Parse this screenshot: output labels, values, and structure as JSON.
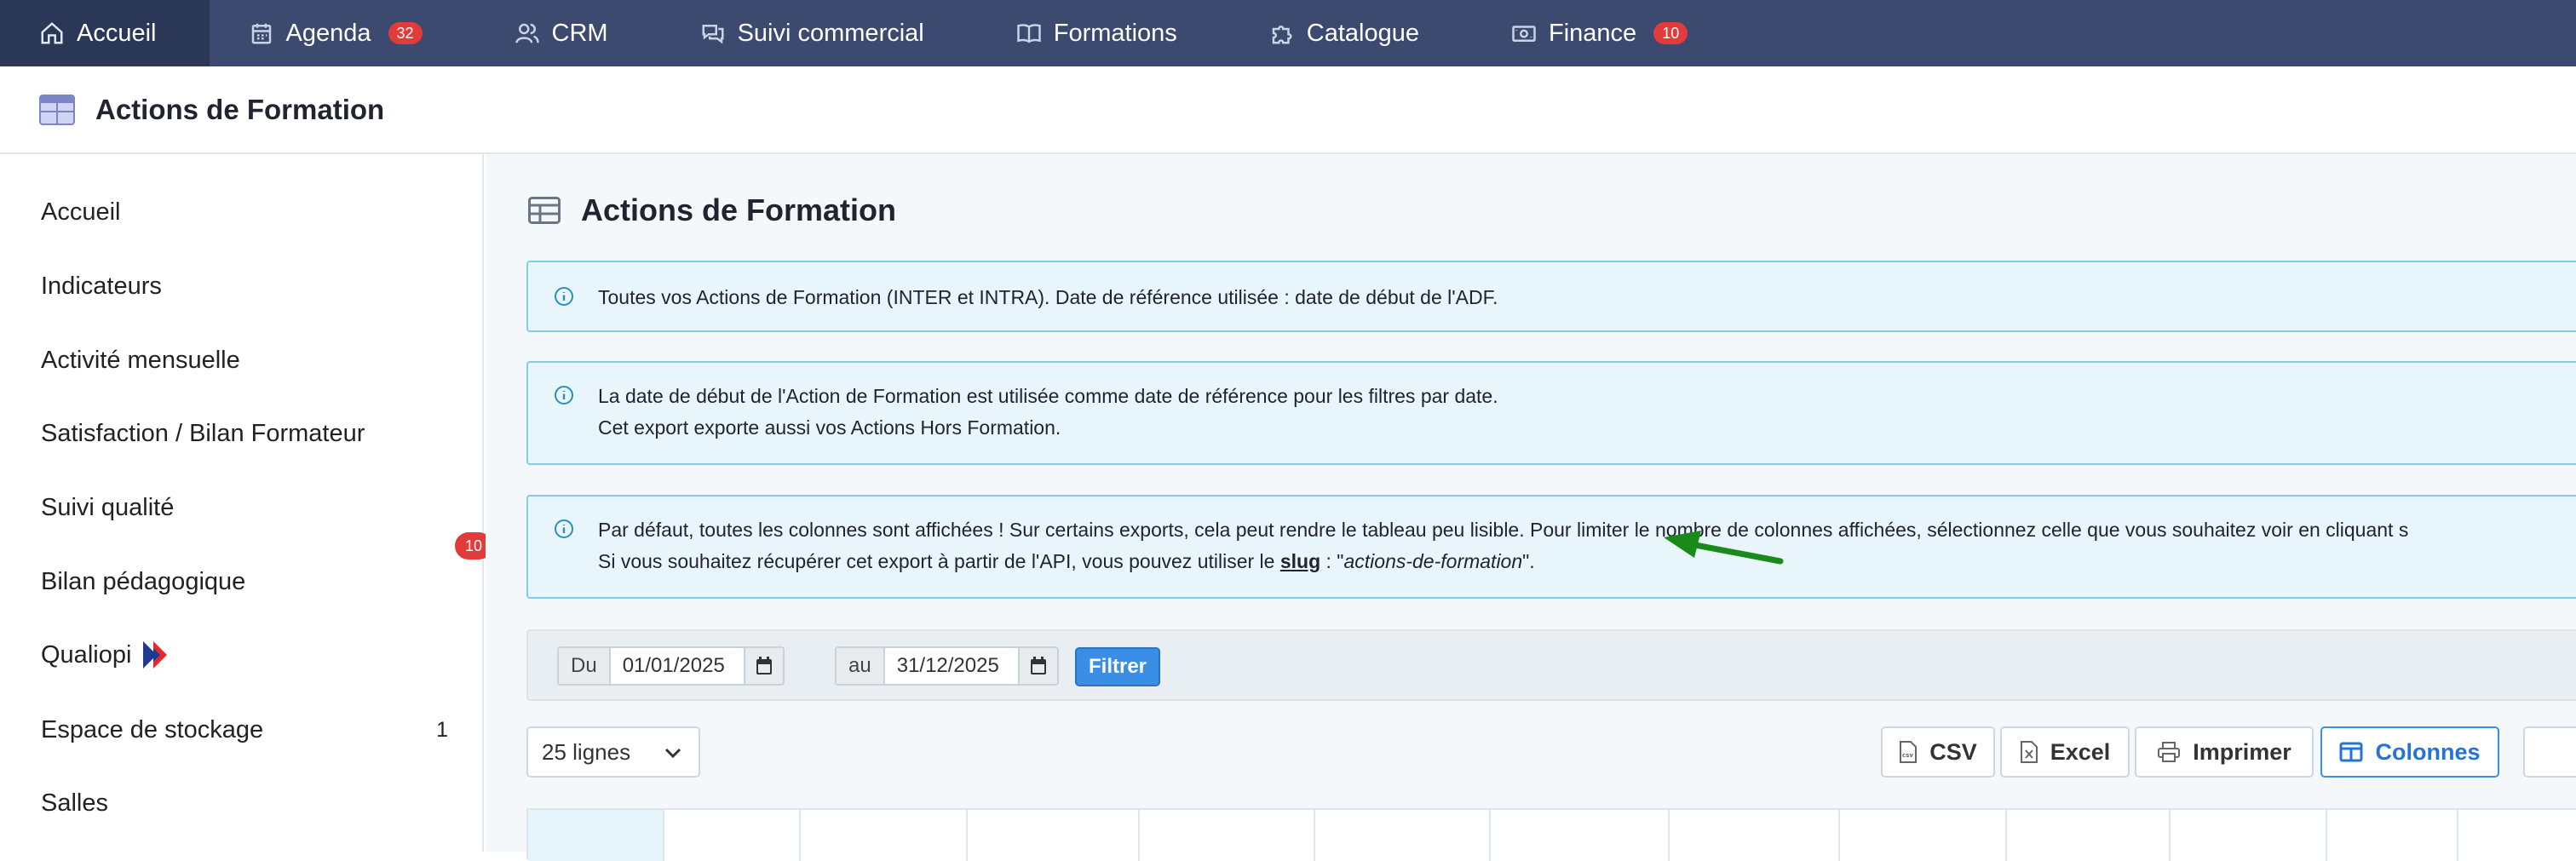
{
  "topnav": {
    "items": [
      {
        "label": "Accueil",
        "icon": "home-icon",
        "active": true
      },
      {
        "label": "Agenda",
        "icon": "calendar-icon",
        "badge": "32"
      },
      {
        "label": "CRM",
        "icon": "users-icon"
      },
      {
        "label": "Suivi commercial",
        "icon": "chat-icon"
      },
      {
        "label": "Formations",
        "icon": "book-icon"
      },
      {
        "label": "Catalogue",
        "icon": "puzzle-icon"
      },
      {
        "label": "Finance",
        "icon": "money-icon",
        "badge": "10"
      }
    ],
    "colors": {
      "background": "#3b4a6e",
      "active": "#2a3756",
      "badge": "#e23b3b"
    }
  },
  "page_header": {
    "title": "Actions de Formation",
    "icon": "table-icon"
  },
  "sidebar": {
    "items": [
      {
        "label": "Accueil"
      },
      {
        "label": "Indicateurs"
      },
      {
        "label": "Activité mensuelle"
      },
      {
        "label": "Satisfaction / Bilan Formateur"
      },
      {
        "label": "Suivi qualité"
      },
      {
        "label": "Bilan pédagogique"
      },
      {
        "label": "Qualiopi",
        "icon": "qualiopi-logo-icon"
      },
      {
        "label": "Espace de stockage",
        "count": "1"
      },
      {
        "label": "Salles"
      }
    ],
    "badge": "10"
  },
  "main": {
    "title": "Actions de Formation",
    "alerts": [
      {
        "lines": [
          "Toutes vos Actions de Formation (INTER et INTRA). Date de référence utilisée : date de début de l'ADF."
        ]
      },
      {
        "lines": [
          "La date de début de l'Action de Formation est utilisée comme date de référence pour les filtres par date.",
          "Cet export exporte aussi vos Actions Hors Formation."
        ]
      },
      {
        "line1": "Par défaut, toutes les colonnes sont affichées ! Sur certains exports, cela peut rendre le tableau peu lisible. Pour limiter le nombre de colonnes affichées, sélectionnez celle que vous souhaitez voir en cliquant s",
        "line2_prefix": "Si vous souhaitez récupérer cet export à partir de l'API, vous pouvez utiliser le ",
        "slug_label": "slug",
        "line2_mid": " : \"",
        "slug_value": "actions-de-formation",
        "line2_suffix": "\"."
      }
    ],
    "filter": {
      "from_label": "Du",
      "from_value": "01/01/2025",
      "to_label": "au",
      "to_value": "31/12/2025",
      "button": "Filtrer"
    },
    "page_size": "25 lignes",
    "toolbar": {
      "csv": "CSV",
      "excel": "Excel",
      "print": "Imprimer",
      "columns": "Colonnes"
    },
    "accent_color": "#3a8ee6",
    "annotation_arrow_color": "#1a8a1a"
  }
}
